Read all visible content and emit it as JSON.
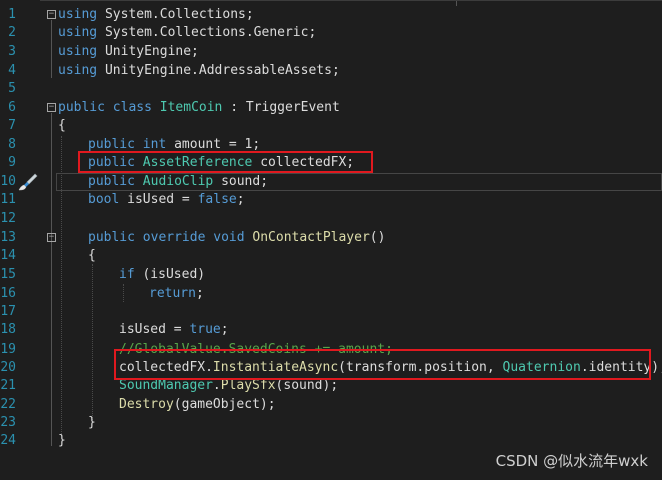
{
  "editor": {
    "line_numbers": [
      "1",
      "2",
      "3",
      "4",
      "5",
      "6",
      "7",
      "8",
      "9",
      "10",
      "11",
      "12",
      "13",
      "14",
      "15",
      "16",
      "17",
      "18",
      "19",
      "20",
      "21",
      "22",
      "23",
      "24"
    ],
    "l1": {
      "kw": "using",
      "rest": " System.Collections;"
    },
    "l2": {
      "kw": "using",
      "rest": " System.Collections.Generic;"
    },
    "l3": {
      "kw": "using",
      "rest": " UnityEngine;"
    },
    "l4": {
      "kw": "using",
      "rest": " UnityEngine.AddressableAssets;"
    },
    "l6": {
      "kw1": "public",
      "kw2": "class",
      "name": "ItemCoin",
      "rest": " : TriggerEvent"
    },
    "l7": {
      "text": "{"
    },
    "l8": {
      "kw1": "public",
      "kw2": "int",
      "rest": " amount = 1;"
    },
    "l9": {
      "kw": "public",
      "type": "AssetReference",
      "rest": " collectedFX;"
    },
    "l10": {
      "kw": "public",
      "type": "AudioClip",
      "rest": " sound;"
    },
    "l11": {
      "kw1": "bool",
      "rest": " isUsed = ",
      "kw2": "false",
      "end": ";"
    },
    "l13": {
      "kw1": "public",
      "kw2": "override",
      "kw3": "void",
      "fn": "OnContactPlayer",
      "rest": "()"
    },
    "l14": {
      "text": "{"
    },
    "l15": {
      "kw": "if",
      "rest": " (isUsed)"
    },
    "l16": {
      "kw": "return",
      "rest": ";"
    },
    "l18": {
      "rest": "isUsed = ",
      "kw": "true",
      "end": ";"
    },
    "l19": {
      "comment": "//GlobalValue.SavedCoins += amount;"
    },
    "l20": {
      "a": "collectedFX.",
      "fn": "InstantiateAsync",
      "b": "(transform.position, ",
      "type": "Quaternion",
      "c": ".identity);"
    },
    "l21": {
      "type": "SoundManager",
      "a": ".",
      "fn": "PlaySfx",
      "b": "(sound);"
    },
    "l22": {
      "fn": "Destroy",
      "b": "(gameObject);"
    },
    "l23": {
      "text": "}"
    },
    "l24": {
      "text": "}"
    }
  },
  "watermark": "CSDN @似水流年wxk",
  "colors": {
    "background": "#1e1e1e",
    "keyword": "#569cd6",
    "type": "#4ec9b0",
    "method": "#dcdcaa",
    "comment": "#57a64a",
    "line_number": "#2b91af",
    "highlight_box": "#e0191f"
  },
  "icons": [
    "paintbrush-icon",
    "collapse-icon"
  ]
}
